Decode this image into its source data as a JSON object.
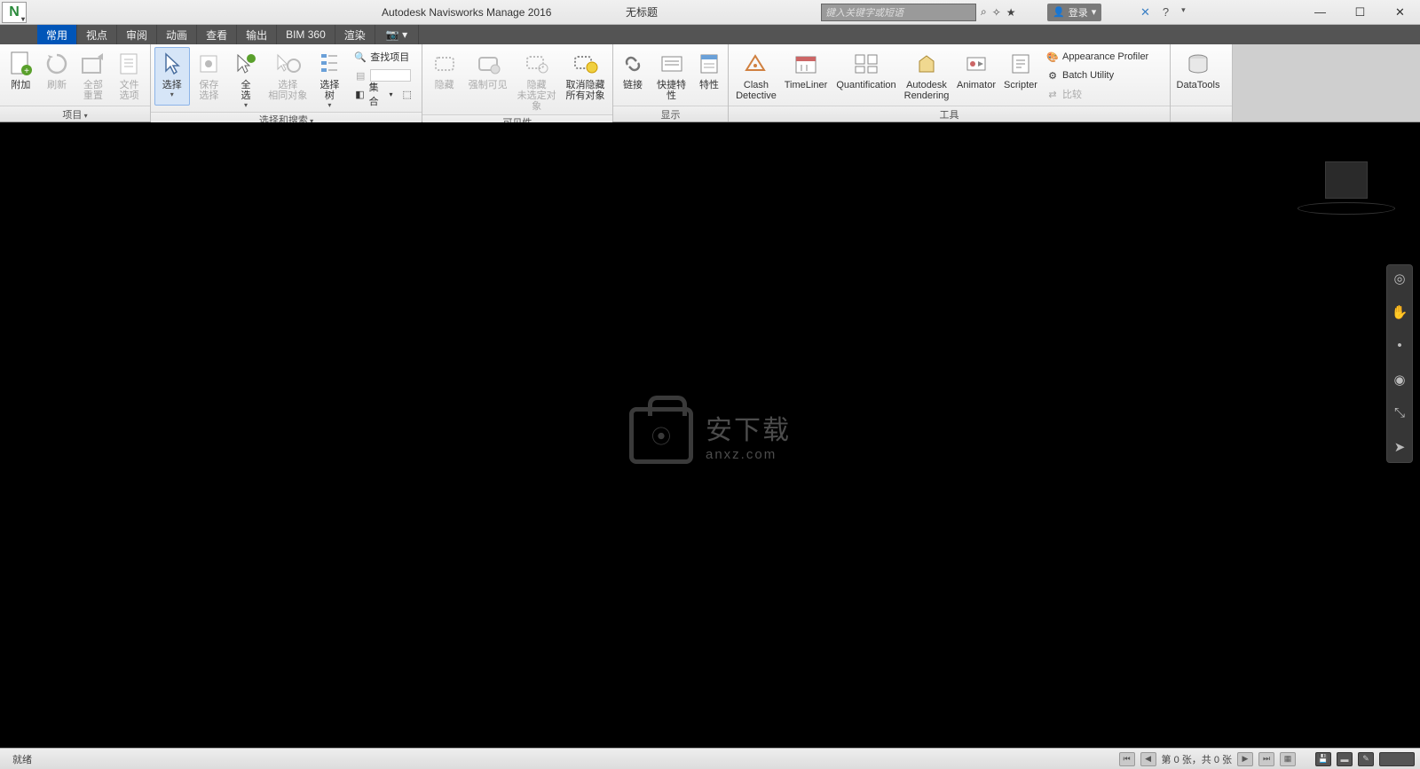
{
  "title": {
    "app": "Autodesk Navisworks Manage 2016",
    "doc": "无标题"
  },
  "search": {
    "placeholder": "键入关键字或短语"
  },
  "login": {
    "label": "登录"
  },
  "tabs": [
    "常用",
    "视点",
    "审阅",
    "动画",
    "查看",
    "输出",
    "BIM 360",
    "渲染"
  ],
  "ribbon": {
    "project": {
      "title": "项目",
      "append": "附加",
      "refresh": "刷新",
      "reset": "全部\n重置",
      "fileopt": "文件\n选项"
    },
    "select": {
      "title": "选择和搜索",
      "select": "选择",
      "savesel": "保存\n选择",
      "selall": "全\n选",
      "selsame": "选择\n相同对象",
      "seltree": "选择\n树",
      "find": "查找项目",
      "sets": "集合"
    },
    "visibility": {
      "title": "可见性",
      "hide": "隐藏",
      "req": "强制可见",
      "hideun": "隐藏\n未选定对象",
      "unhide": "取消隐藏\n所有对象"
    },
    "display": {
      "title": "显示",
      "links": "链接",
      "quick": "快捷特性",
      "props": "特性"
    },
    "tools": {
      "title": "工具",
      "clash": "Clash\nDetective",
      "timeliner": "TimeLiner",
      "quant": "Quantification",
      "render": "Autodesk\nRendering",
      "animator": "Animator",
      "scripter": "Scripter",
      "appearance": "Appearance Profiler",
      "batch": "Batch Utility",
      "compare": "比较",
      "datatools": "DataTools"
    }
  },
  "watermark": {
    "line1": "安下载",
    "line2": "anxz.com"
  },
  "status": {
    "ready": "就绪",
    "pager": "第 0 张，共 0 张"
  }
}
